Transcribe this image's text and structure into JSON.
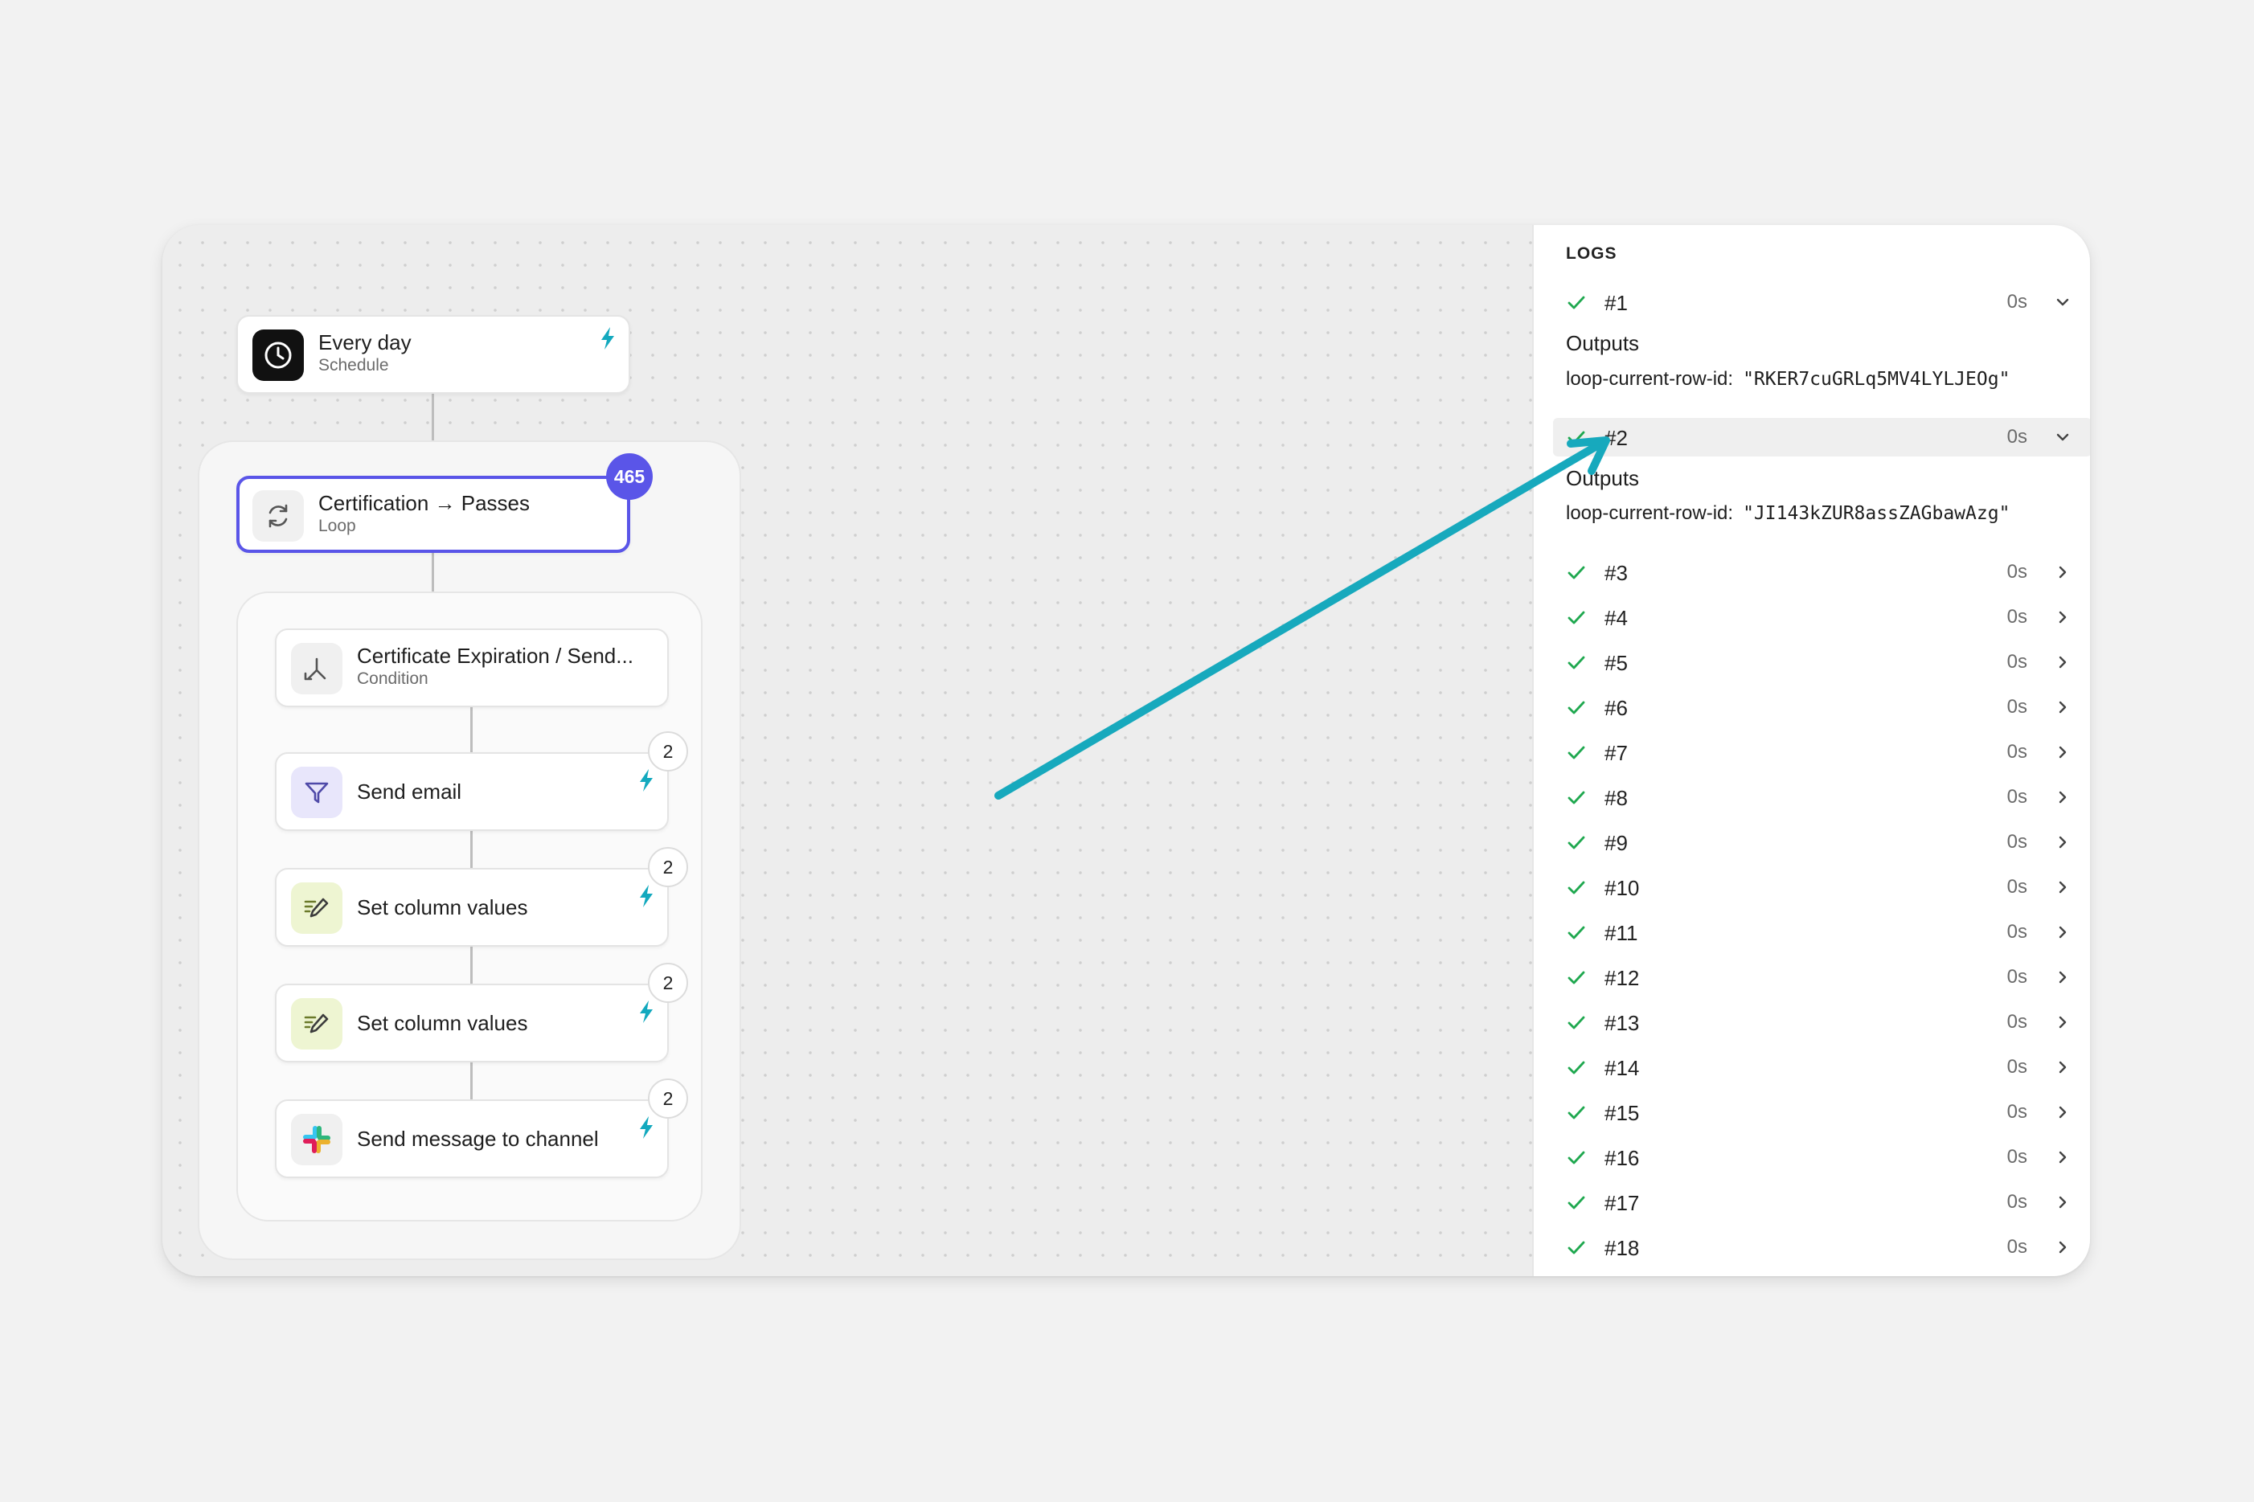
{
  "workflow": {
    "trigger": {
      "title": "Every day",
      "subtitle": "Schedule"
    },
    "loop": {
      "title": "Certification → Passes",
      "subtitle": "Loop",
      "count": "465"
    },
    "steps": [
      {
        "title": "Certificate Expiration / Send...",
        "subtitle": "Condition",
        "icon": "branch-icon"
      },
      {
        "title": "Send email",
        "badge": "2",
        "icon": "send-icon"
      },
      {
        "title": "Set column values",
        "badge": "2",
        "icon": "edit-columns-icon"
      },
      {
        "title": "Set column values",
        "badge": "2",
        "icon": "edit-columns-icon"
      },
      {
        "title": "Send message to channel",
        "badge": "2",
        "icon": "slack-icon"
      }
    ]
  },
  "logs": {
    "title": "LOGS",
    "outputs_label": "Outputs",
    "entries": [
      {
        "id": "#1",
        "duration": "0s",
        "expanded": true,
        "output_key": "loop-current-row-id:",
        "output_value": "\"RKER7cuGRLq5MV4LYLJEOg\""
      },
      {
        "id": "#2",
        "duration": "0s",
        "expanded": true,
        "highlighted": true,
        "output_key": "loop-current-row-id:",
        "output_value": "\"JI143kZUR8assZAGbawAzg\""
      },
      {
        "id": "#3",
        "duration": "0s"
      },
      {
        "id": "#4",
        "duration": "0s"
      },
      {
        "id": "#5",
        "duration": "0s"
      },
      {
        "id": "#6",
        "duration": "0s"
      },
      {
        "id": "#7",
        "duration": "0s"
      },
      {
        "id": "#8",
        "duration": "0s"
      },
      {
        "id": "#9",
        "duration": "0s"
      },
      {
        "id": "#10",
        "duration": "0s"
      },
      {
        "id": "#11",
        "duration": "0s"
      },
      {
        "id": "#12",
        "duration": "0s"
      },
      {
        "id": "#13",
        "duration": "0s"
      },
      {
        "id": "#14",
        "duration": "0s"
      },
      {
        "id": "#15",
        "duration": "0s"
      },
      {
        "id": "#16",
        "duration": "0s"
      },
      {
        "id": "#17",
        "duration": "0s"
      },
      {
        "id": "#18",
        "duration": "0s"
      }
    ]
  },
  "colors": {
    "accent": "#5a55e8",
    "success": "#1fa84f",
    "bolt": "#13a9be",
    "annotation_arrow": "#17a9bd"
  }
}
